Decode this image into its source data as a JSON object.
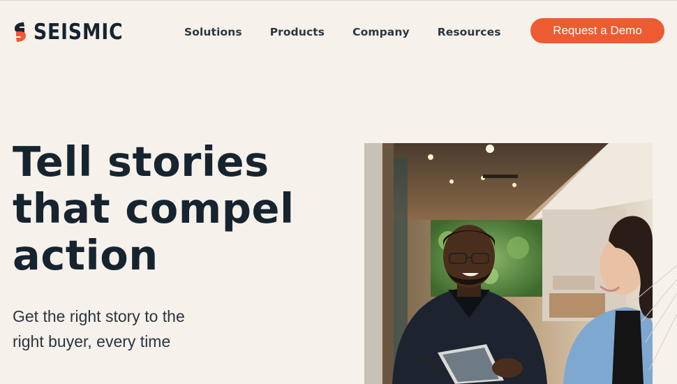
{
  "header": {
    "logo_text": "SEISMIC",
    "nav": [
      "Solutions",
      "Products",
      "Company",
      "Resources"
    ],
    "cta_label": "Request a Demo"
  },
  "hero": {
    "title_lines": [
      "Tell stories",
      "that compel",
      "action"
    ],
    "subtitle_lines": [
      "Get the right story to the",
      "right buyer, every time"
    ]
  },
  "colors": {
    "background": "#f6f1eb",
    "brand_orange": "#ee5a31",
    "text_dark": "#16242f"
  },
  "icons": {
    "logo": "seismic-s-logo-icon"
  }
}
